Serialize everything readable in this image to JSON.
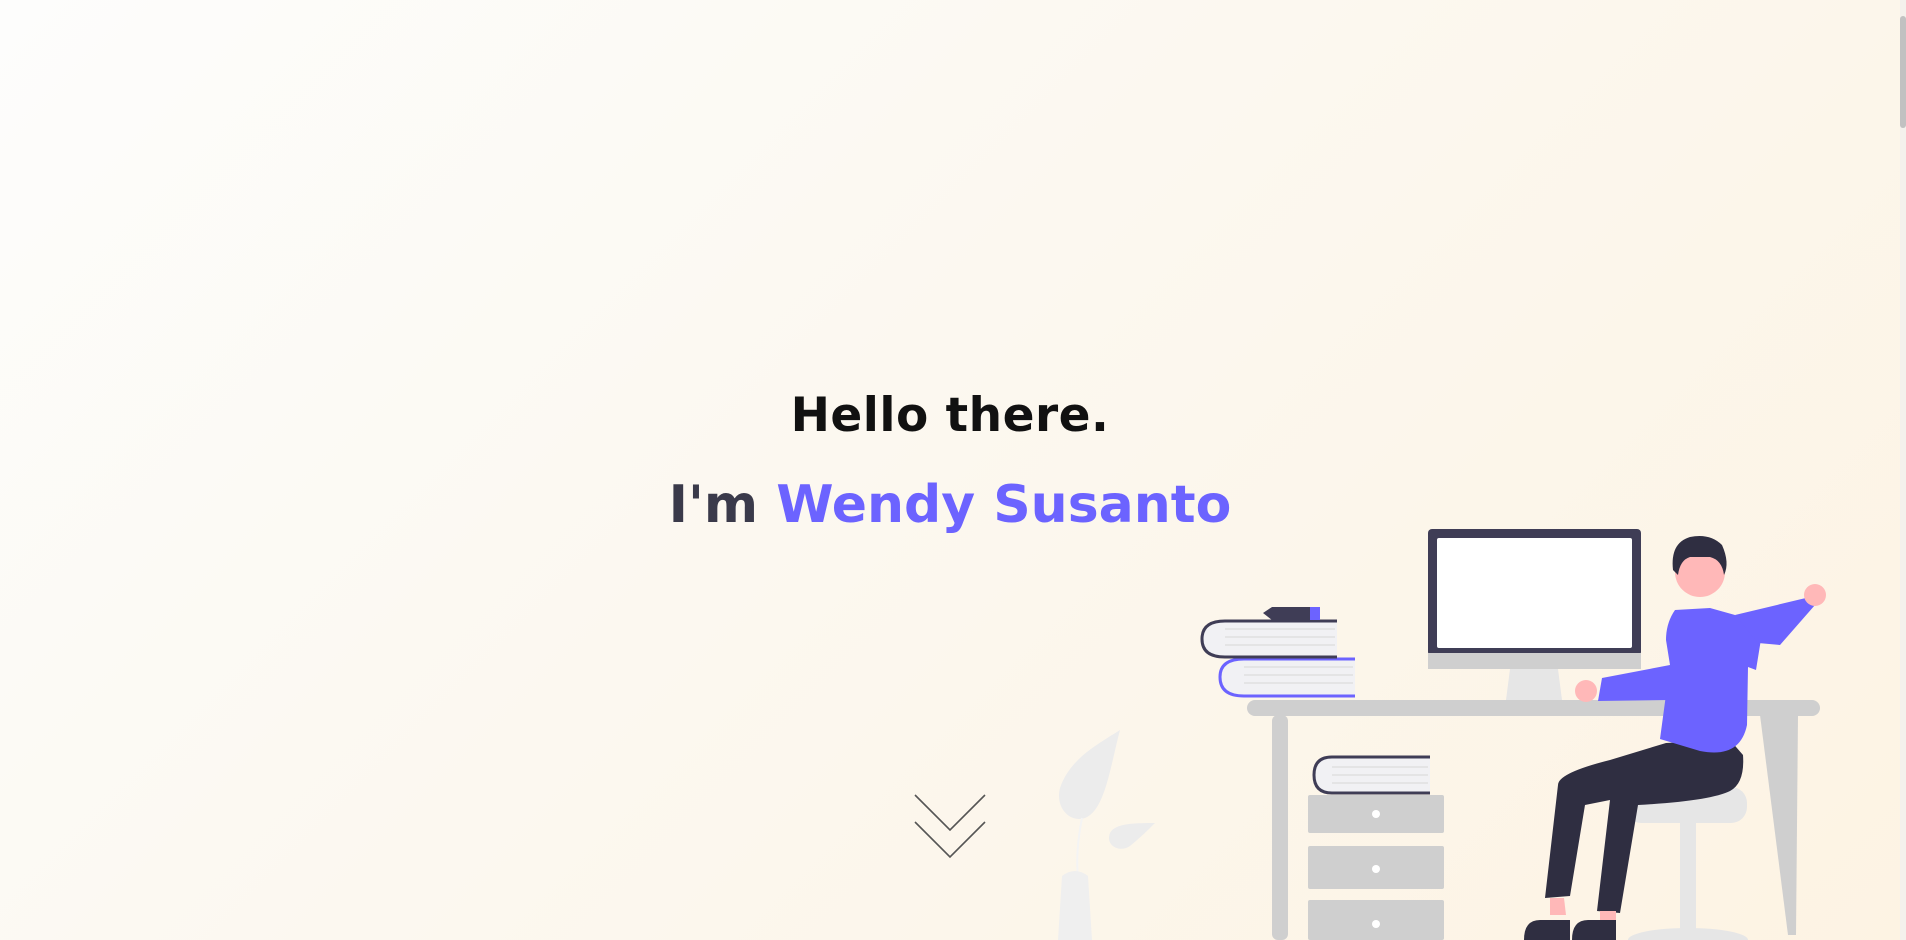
{
  "hero": {
    "greeting": "Hello there.",
    "intro_prefix": "I'm",
    "name": "Wendy Susanto"
  },
  "colors": {
    "accent": "#6c63ff",
    "heading": "#111111",
    "dark_text": "#3a3a4a",
    "background": "#fdf7ee"
  },
  "icons": {
    "scroll_down": "double-chevron-down-icon"
  }
}
